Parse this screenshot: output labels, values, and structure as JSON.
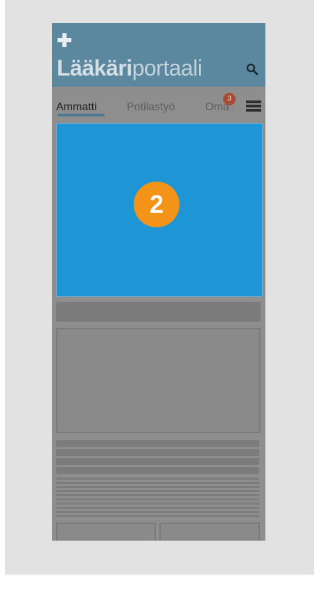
{
  "app": {
    "logo_bold": "Lääkäri",
    "logo_light": "portaali"
  },
  "tabs": [
    {
      "label": "Ammatti",
      "active": true
    },
    {
      "label": "Potilastyö",
      "active": false
    },
    {
      "label": "Oma",
      "active": false
    }
  ],
  "notification_count": "3",
  "hero": {
    "step_number": "2",
    "color": "#1e96d6",
    "badge_color": "#f39318"
  },
  "icons": [
    "plus-icon",
    "search-icon",
    "menu-icon"
  ],
  "colors": {
    "header": "#5b879f",
    "overlay": "#8e8e8e",
    "frame": "#e2e2e2"
  }
}
